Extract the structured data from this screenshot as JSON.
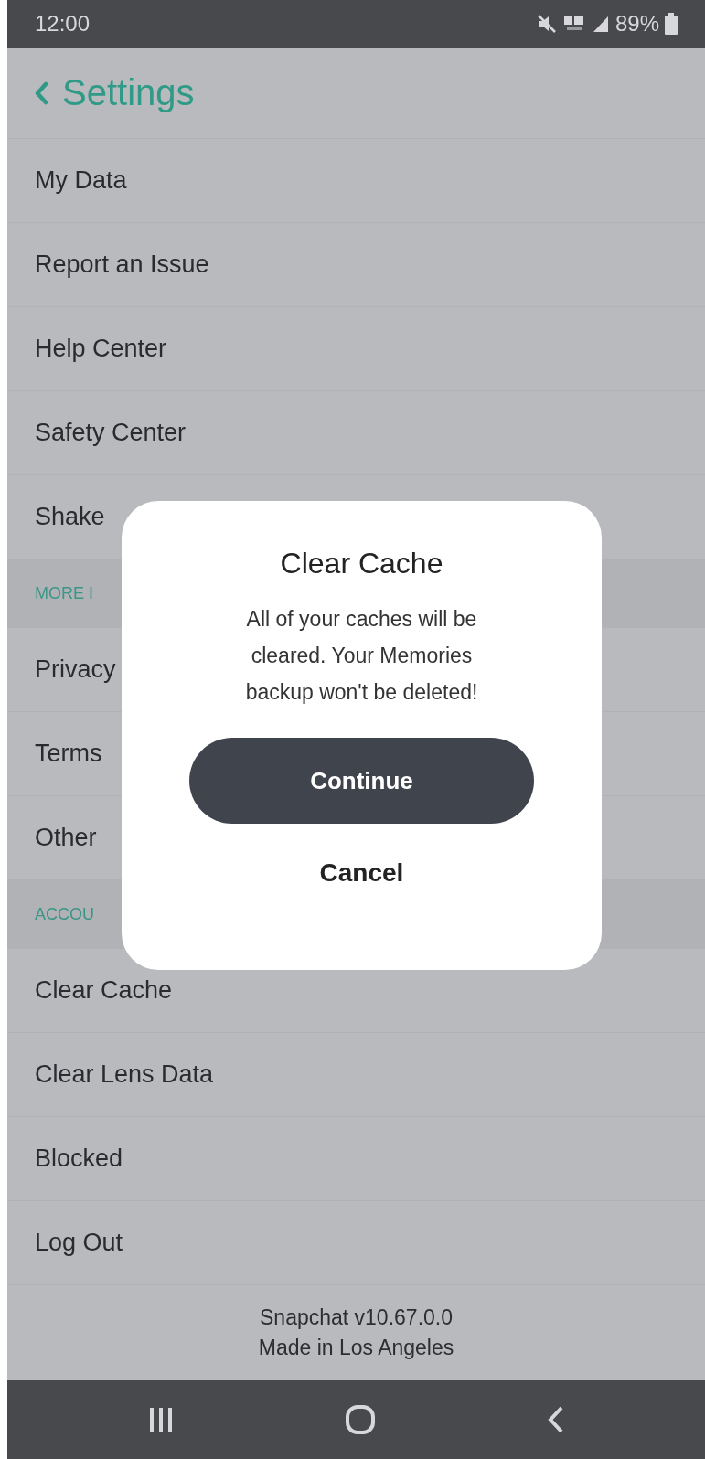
{
  "status_bar": {
    "time": "12:00",
    "battery": "89%"
  },
  "header": {
    "title": "Settings"
  },
  "rows": [
    {
      "kind": "item",
      "label": "My Data"
    },
    {
      "kind": "item",
      "label": "Report an Issue"
    },
    {
      "kind": "item",
      "label": "Help Center"
    },
    {
      "kind": "item",
      "label": "Safety Center"
    },
    {
      "kind": "item",
      "label": "Shake"
    },
    {
      "kind": "section",
      "label": "MORE I"
    },
    {
      "kind": "item",
      "label": "Privacy"
    },
    {
      "kind": "item",
      "label": "Terms"
    },
    {
      "kind": "item",
      "label": "Other"
    },
    {
      "kind": "section",
      "label": "ACCOU"
    },
    {
      "kind": "item",
      "label": "Clear Cache"
    },
    {
      "kind": "item",
      "label": "Clear Lens Data"
    },
    {
      "kind": "item",
      "label": "Blocked"
    },
    {
      "kind": "item",
      "label": "Log Out"
    }
  ],
  "footer": [
    "Snapchat v10.67.0.0",
    "Made in Los Angeles"
  ],
  "dialog": {
    "title": "Clear Cache",
    "message": "All of your caches will be cleared. Your Memories backup won't be deleted!",
    "buttons": [
      {
        "kind": "primary",
        "label": "Continue"
      },
      {
        "kind": "text",
        "label": "Cancel"
      }
    ]
  }
}
